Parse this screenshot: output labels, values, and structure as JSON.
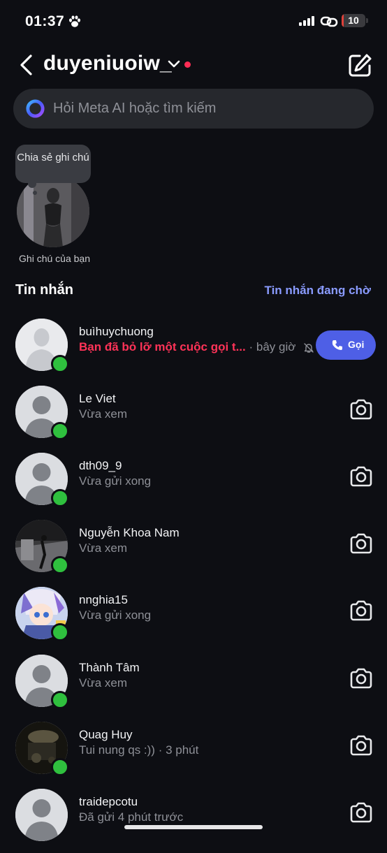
{
  "status_bar": {
    "time": "01:37",
    "battery": "10",
    "battery_level": 0.1
  },
  "header": {
    "username": "duyeniuoiw_"
  },
  "search": {
    "placeholder": "Hỏi Meta AI hoặc tìm kiếm"
  },
  "note": {
    "bubble_text": "Chia sẻ ghi chú",
    "label": "Ghi chú của bạn"
  },
  "messages_section": {
    "title": "Tin nhắn",
    "pending_link": "Tin nhắn đang chờ"
  },
  "conversations": [
    {
      "name": "buìhuychuong",
      "alert": "Bạn đã bỏ lỡ một cuộc gọi t...",
      "time": "· bây giờ",
      "action": "Gọi",
      "online": true
    },
    {
      "name": "Le Viet",
      "status": "Vừa xem",
      "online": true
    },
    {
      "name": "dth09_9",
      "status": "Vừa gửi xong",
      "online": true
    },
    {
      "name": "Nguyễn Khoa Nam",
      "status": "Vừa xem",
      "online": true
    },
    {
      "name": "nnghia15",
      "status": "Vừa gửi xong",
      "online": true
    },
    {
      "name": "Thành Tâm",
      "status": "Vừa xem",
      "online": true
    },
    {
      "name": "Quag Huy",
      "status": "Tui nung qs :)) · 3 phút",
      "online": true
    },
    {
      "name": "traidepcotu",
      "status": "Đã gửi 4 phút trước",
      "online": false
    }
  ]
}
